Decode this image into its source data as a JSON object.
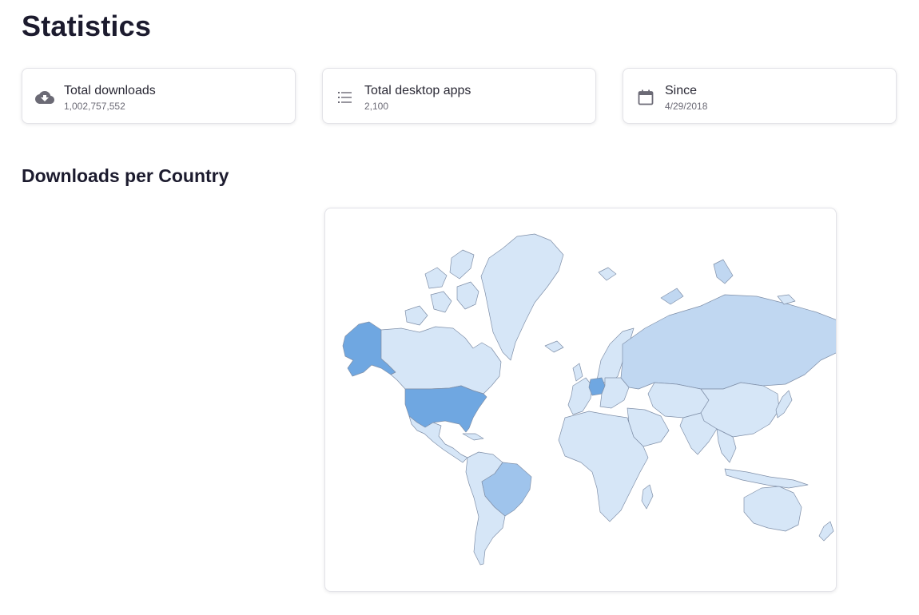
{
  "page": {
    "title": "Statistics"
  },
  "stats": [
    {
      "label": "Total downloads",
      "value": "1,002,757,552",
      "icon": "cloud-download-icon"
    },
    {
      "label": "Total desktop apps",
      "value": "2,100",
      "icon": "list-icon"
    },
    {
      "label": "Since",
      "value": "4/29/2018",
      "icon": "calendar-icon"
    }
  ],
  "map": {
    "title": "Downloads per Country",
    "colors": {
      "highest": "#6fa7e1",
      "high": "#9fc4ec",
      "medium": "#c0d7f1",
      "low": "#d6e6f7",
      "border": "#7f8fa8"
    },
    "country_shading": [
      {
        "country": "United States",
        "level": "highest"
      },
      {
        "country": "Germany",
        "level": "highest"
      },
      {
        "country": "Brazil",
        "level": "high"
      },
      {
        "country": "Russia",
        "level": "medium"
      },
      {
        "country": "Canada",
        "level": "low"
      }
    ]
  }
}
